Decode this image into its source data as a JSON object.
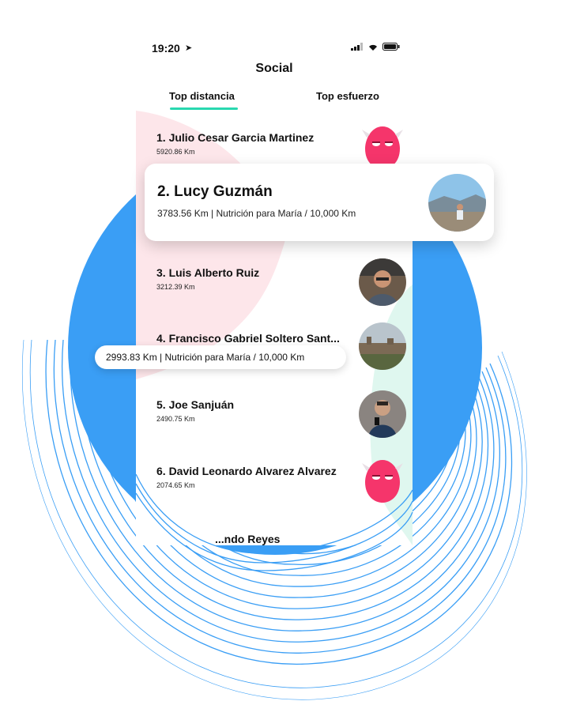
{
  "status": {
    "time": "19:20"
  },
  "title": "Social",
  "tabs": [
    {
      "label": "Top distancia",
      "active": true
    },
    {
      "label": "Top esfuerzo",
      "active": false
    }
  ],
  "ranking": [
    {
      "name": "1. Julio Cesar Garcia Martinez",
      "distance": "5920.86 Km",
      "avatar": "monster-avatar"
    },
    {
      "name": "3. Luis Alberto Ruiz",
      "distance": "3212.39 Km",
      "avatar": "photo-avatar"
    },
    {
      "name": "4. Francisco Gabriel Soltero Sant...",
      "distance": "",
      "avatar": "landscape-avatar"
    },
    {
      "name": "5. Joe Sanjuán",
      "distance": "2490.75 Km",
      "avatar": "photo-avatar"
    },
    {
      "name": "6. David Leonardo Alvarez Alvarez",
      "distance": "2074.65 Km",
      "avatar": "monster-avatar"
    },
    {
      "name": "...ndo Reyes",
      "distance": "",
      "avatar": ""
    }
  ],
  "highlight_card": {
    "name": "2. Lucy Guzmán",
    "detail": "3783.56 Km | Nutrición para María / 10,000 Km"
  },
  "floating_pill": {
    "detail": "2993.83 Km | Nutrición para María / 10,000 Km"
  },
  "colors": {
    "accent": "#29d8b0",
    "blue_circle": "#3a9ef5",
    "pink_shape": "#fde6ea",
    "mint_shape": "#dff7ef",
    "monster": "#f5356b"
  }
}
